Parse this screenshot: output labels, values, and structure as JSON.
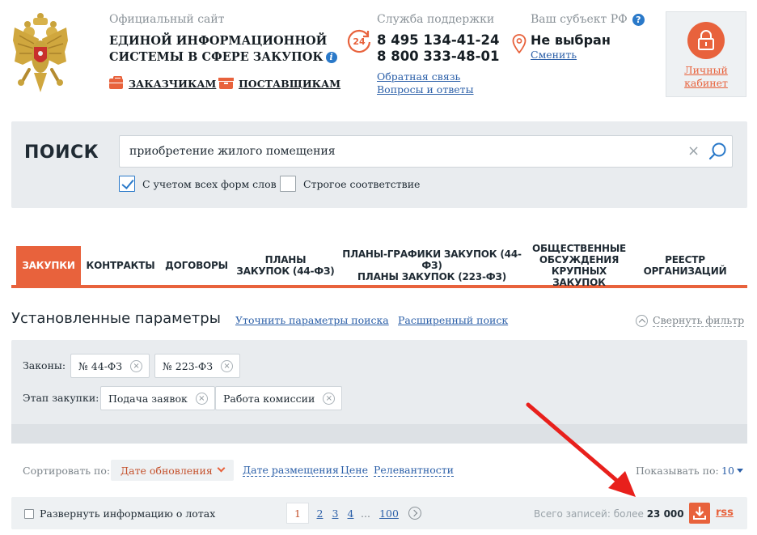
{
  "header": {
    "site_small": "Официальный сайт",
    "site_title_line1": "ЕДИНОЙ ИНФОРМАЦИОННОЙ",
    "site_title_line2": "СИСТЕМЫ В СФЕРЕ ЗАКУПОК",
    "info_glyph": "i",
    "customers_link": "ЗАКАЗЧИКАМ",
    "suppliers_link": "ПОСТАВЩИКАМ",
    "support_label": "Служба поддержки",
    "support_badge": "24",
    "phone1": "8 495 134-41-24",
    "phone2": "8 800 333-48-01",
    "feedback_link": "Обратная связь",
    "faq_link": "Вопросы и ответы",
    "region_label": "Ваш субъект РФ",
    "region_help_glyph": "?",
    "region_value": "Не выбран",
    "region_change": "Сменить",
    "cabinet_line1": "Личный",
    "cabinet_line2": "кабинет"
  },
  "search": {
    "title": "ПОИСК",
    "query": "приобретение жилого помещения",
    "clear_glyph": "×",
    "option_all_forms": "С учетом всех форм слов",
    "option_all_forms_checked": true,
    "option_strict": "Строгое соответствие",
    "option_strict_checked": false
  },
  "tabs": [
    {
      "line1": "ЗАКУПКИ",
      "line2": "",
      "line3": "",
      "active": true
    },
    {
      "line1": "КОНТРАКТЫ",
      "line2": "",
      "line3": "",
      "active": false
    },
    {
      "line1": "ДОГОВОРЫ",
      "line2": "",
      "line3": "",
      "active": false
    },
    {
      "line1": "ПЛАНЫ",
      "line2": "ЗАКУПОК (44-ФЗ)",
      "line3": "",
      "active": false
    },
    {
      "line1": "ПЛАНЫ-ГРАФИКИ ЗАКУПОК (44-ФЗ)",
      "line2": "ПЛАНЫ ЗАКУПОК (223-ФЗ)",
      "line3": "",
      "active": false
    },
    {
      "line1": "ОБЩЕСТВЕННЫЕ",
      "line2": "ОБСУЖДЕНИЯ",
      "line3": "КРУПНЫХ ЗАКУПОК",
      "active": false
    },
    {
      "line1": "РЕЕСТР",
      "line2": "ОРГАНИЗАЦИЙ",
      "line3": "",
      "active": false
    }
  ],
  "params": {
    "title": "Установленные параметры",
    "refine_link": "Уточнить параметры поиска",
    "advanced_link": "Расширенный поиск",
    "collapse_label": "Свернуть фильтр",
    "laws_label": "Законы:",
    "laws": [
      "№ 44-ФЗ",
      "№ 223-ФЗ"
    ],
    "stage_label": "Этап закупки:",
    "stages": [
      "Подача заявок",
      "Работа комиссии"
    ],
    "chip_remove_glyph": "×"
  },
  "sort": {
    "label": "Сортировать по:",
    "active": "Дате обновления",
    "options": [
      "Дате размещения",
      "Цене",
      "Релевантности"
    ],
    "show_label": "Показывать по:",
    "show_value": "10"
  },
  "results": {
    "expand_label": "Развернуть информацию о лотах",
    "pages": [
      "1",
      "2",
      "3",
      "4",
      "...",
      "100"
    ],
    "current_page": 1,
    "total_label": "Всего записей: более",
    "total_value": "23 000",
    "rss_label": "rss"
  },
  "colors": {
    "accent": "#e8623c",
    "link": "#2b5fa8",
    "panel": "#e9ecef",
    "annotation_arrow": "#e8201c"
  },
  "icons": {
    "emblem": "russian-coat-of-arms",
    "support": "clock-24-icon",
    "region": "location-pin-icon",
    "cabinet": "lock-icon",
    "search": "search-icon",
    "download": "download-icon"
  }
}
